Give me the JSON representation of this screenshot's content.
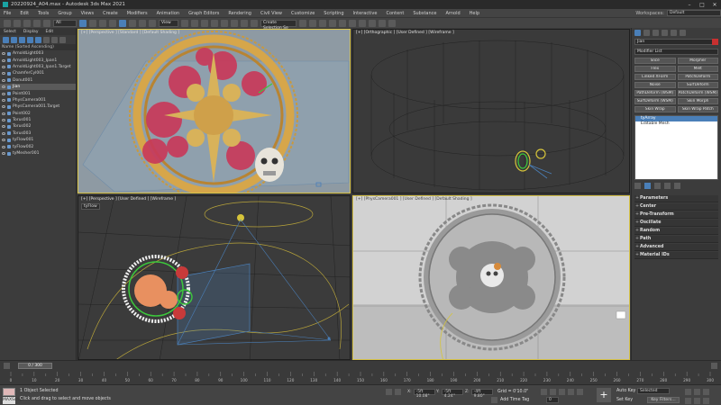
{
  "window": {
    "title": "20220924_A04.max - Autodesk 3ds Max 2021"
  },
  "menu": [
    "File",
    "Edit",
    "Tools",
    "Group",
    "Views",
    "Create",
    "Modifiers",
    "Animation",
    "Graph Editors",
    "Rendering",
    "Civil View",
    "Customize",
    "Scripting",
    "Interactive",
    "Content",
    "Substance",
    "Arnold",
    "Help"
  ],
  "workspace": {
    "label": "Workspaces:",
    "value": "Default"
  },
  "toolbar": {
    "filter": "All",
    "view": "View",
    "selection_set": "Create Selection Se"
  },
  "scene_explorer": {
    "tabs": [
      "Select",
      "Display",
      "Edit"
    ],
    "header": "Name (Sorted Ascending)",
    "items": [
      {
        "name": "ArnoldLight003",
        "selected": false
      },
      {
        "name": "ArnoldLight003_Ipan1",
        "selected": false
      },
      {
        "name": "ArnoldLight003_Ipan1.Target",
        "selected": false
      },
      {
        "name": "ChamferCyl001",
        "selected": false
      },
      {
        "name": "Donut001",
        "selected": false
      },
      {
        "name": "Jian",
        "selected": true
      },
      {
        "name": "Point001",
        "selected": false
      },
      {
        "name": "PhysCamera001",
        "selected": false
      },
      {
        "name": "PhysCamera001.Target",
        "selected": false
      },
      {
        "name": "Point002",
        "selected": false
      },
      {
        "name": "Torus001",
        "selected": false
      },
      {
        "name": "Torus002",
        "selected": false
      },
      {
        "name": "Torus003",
        "selected": false
      },
      {
        "name": "tyFlow001",
        "selected": false
      },
      {
        "name": "tyFlow002",
        "selected": false
      },
      {
        "name": "tyMesher001",
        "selected": false
      }
    ]
  },
  "viewports": {
    "top_left": "[+] [Perspective ] [Standard ] [Default Shading ]",
    "top_right": "[+] [Orthographic ] [User Defined ] [Wireframe ]",
    "bottom_left": "[+] [Perspective ] [User Defined ] [Wireframe ]",
    "bottom_left_tag": "tyFlow",
    "bottom_right": "[+] [PhysCamera001 ] [User Defined ] [Default Shading ]"
  },
  "command_panel": {
    "object_name": "Jian",
    "modifier_list": "Modifier List",
    "modifier_buttons": [
      "Slice",
      "Morpher",
      "Flex",
      "Melt",
      "Linked XForm",
      "PatchDeform",
      "Noise",
      "SurfDeform",
      "PathDeform (WSM)",
      "PatchDeform (WSM)",
      "SurfDeform (WSM)",
      "Skin Morph",
      "Skin Wrap",
      "Skin Wrap Patch"
    ],
    "stack": [
      {
        "name": "tyArray",
        "selected": true
      },
      {
        "name": "Editable Mesh",
        "selected": false
      }
    ],
    "rollouts": [
      "Parameters",
      "Center",
      "Pre-Transform",
      "Oscillate",
      "Random",
      "Path",
      "Advanced",
      "Material IDs"
    ]
  },
  "time": {
    "slider": "0 / 300",
    "ticks": [
      "0",
      "10",
      "20",
      "30",
      "40",
      "50",
      "60",
      "70",
      "80",
      "90",
      "100",
      "110",
      "120",
      "130",
      "140",
      "150",
      "160",
      "170",
      "180",
      "190",
      "200",
      "210",
      "220",
      "230",
      "240",
      "250",
      "260",
      "270",
      "280",
      "290",
      "300"
    ]
  },
  "status": {
    "selected": "1 Object Selected",
    "hint": "Click and drag to select and move objects",
    "maxscript": "MAXScript",
    "x": "-5ft 10.08\"",
    "y": "-5ft 4.24\"",
    "z": "-4ft 9.80\"",
    "grid": "Grid = 0'10.0\"",
    "add_time_tag": "Add Time Tag",
    "auto_key": "Auto Key",
    "selected_mode": "Selected",
    "set_key": "Set Key",
    "key_filters": "Key Filters...",
    "frame": "0"
  },
  "colors": {
    "accent": "#4a7fb8",
    "selection_border": "#d8c44a",
    "object_color": "#c83030"
  }
}
